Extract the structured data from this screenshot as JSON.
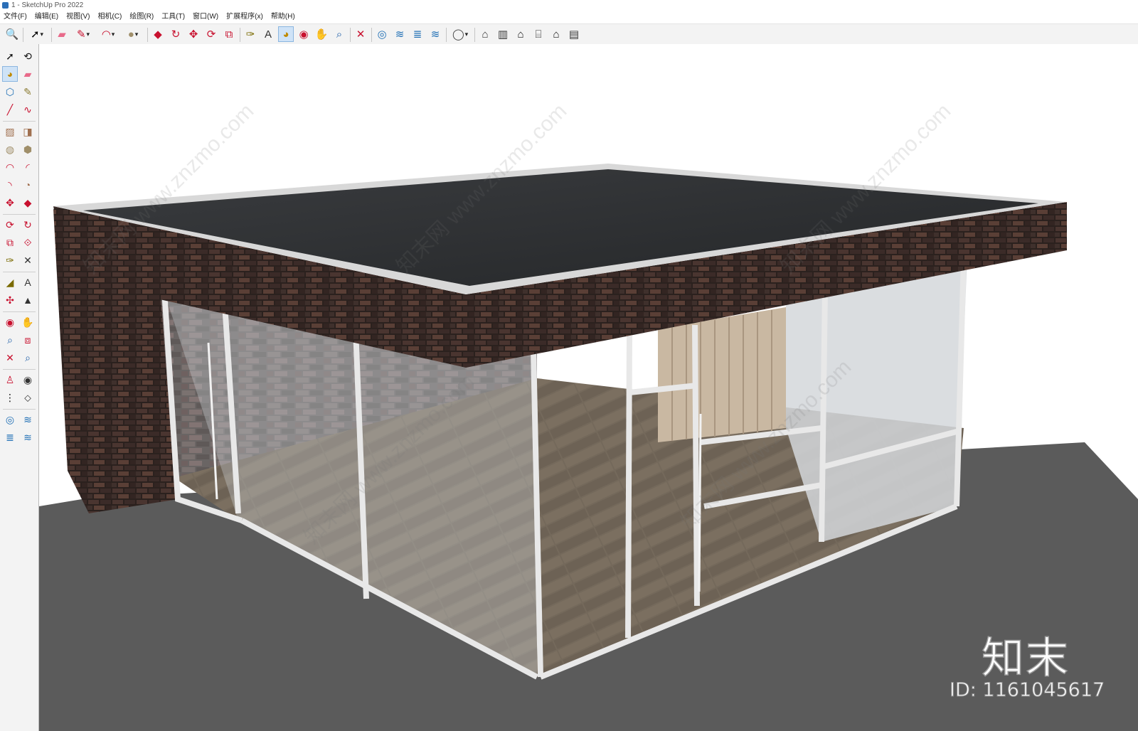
{
  "window": {
    "title": "1 - SketchUp Pro 2022"
  },
  "menu": [
    "文件(F)",
    "编辑(E)",
    "视图(V)",
    "相机(C)",
    "绘图(R)",
    "工具(T)",
    "窗口(W)",
    "扩展程序(x)",
    "帮助(H)"
  ],
  "top_tools": [
    {
      "name": "zoom-icon",
      "glyph": "🔍"
    },
    {
      "name": "select-icon",
      "glyph": "➚",
      "dropdown": true
    },
    {
      "name": "eraser-icon",
      "glyph": "▰",
      "color": "#e86a8a"
    },
    {
      "name": "pencil-icon",
      "glyph": "✎",
      "color": "#c8102e",
      "dropdown": true
    },
    {
      "name": "arc-icon",
      "glyph": "◠",
      "color": "#c8102e",
      "dropdown": true
    },
    {
      "name": "circle-icon",
      "glyph": "●",
      "color": "#a08f6a",
      "dropdown": true
    },
    {
      "name": "push-pull-icon",
      "glyph": "◆",
      "color": "#c8102e"
    },
    {
      "name": "follow-me-icon",
      "glyph": "↻",
      "color": "#c8102e"
    },
    {
      "name": "move-icon",
      "glyph": "✥",
      "color": "#c8102e"
    },
    {
      "name": "rotate-icon",
      "glyph": "⟳",
      "color": "#c8102e"
    },
    {
      "name": "scale-icon",
      "glyph": "⧉",
      "color": "#c8102e"
    },
    {
      "name": "tape-measure-icon",
      "glyph": "✑",
      "color": "#7a6a00"
    },
    {
      "name": "text-icon",
      "glyph": "A",
      "color": "#333"
    },
    {
      "name": "paint-bucket-icon",
      "glyph": "◕",
      "color": "#c08a00",
      "active": true
    },
    {
      "name": "orbit-icon",
      "glyph": "◉",
      "color": "#c8102e"
    },
    {
      "name": "pan-icon",
      "glyph": "✋",
      "color": "#c9a060"
    },
    {
      "name": "zoom-tool-icon",
      "glyph": "⌕",
      "color": "#1f5fa8"
    },
    {
      "name": "zoom-extents-icon",
      "glyph": "✕",
      "color": "#c8102e"
    },
    {
      "name": "warehouse-icon",
      "glyph": "◎",
      "color": "#1f6fb5"
    },
    {
      "name": "extension-warehouse-icon",
      "glyph": "≋",
      "color": "#1f6fb5"
    },
    {
      "name": "layers-icon",
      "glyph": "≣",
      "color": "#1f6fb5"
    },
    {
      "name": "send-to-layout-icon",
      "glyph": "≋",
      "color": "#1f6fb5"
    },
    {
      "name": "account-icon",
      "glyph": "◯",
      "color": "#444",
      "dropdown": true
    },
    {
      "name": "iso-view-icon",
      "glyph": "⌂",
      "color": "#333"
    },
    {
      "name": "top-view-icon",
      "glyph": "▥",
      "color": "#333"
    },
    {
      "name": "front-view-icon",
      "glyph": "⌂",
      "color": "#111"
    },
    {
      "name": "right-view-icon",
      "glyph": "⌸",
      "color": "#333"
    },
    {
      "name": "back-view-icon",
      "glyph": "⌂",
      "color": "#111"
    },
    {
      "name": "left-view-icon",
      "glyph": "▤",
      "color": "#333"
    }
  ],
  "left_tools": [
    {
      "name": "select-icon",
      "glyph": "➚",
      "color": "#111"
    },
    {
      "name": "orbit-icon",
      "glyph": "⟲",
      "color": "#111"
    },
    {
      "name": "paint-bucket-icon",
      "glyph": "◕",
      "color": "#c08a00",
      "active": true
    },
    {
      "name": "eraser-icon",
      "glyph": "▰",
      "color": "#e86a8a"
    },
    {
      "name": "component-icon",
      "glyph": "⬡",
      "color": "#1f6fb5"
    },
    {
      "name": "tag-icon",
      "glyph": "✎",
      "color": "#8a7a30"
    },
    {
      "name": "line-icon",
      "glyph": "╱",
      "color": "#c8102e"
    },
    {
      "name": "freehand-icon",
      "glyph": "∿",
      "color": "#c8102e"
    },
    {
      "name": "rectangle-icon",
      "glyph": "▨",
      "color": "#a07050"
    },
    {
      "name": "rotated-rectangle-icon",
      "glyph": "◨",
      "color": "#a07050"
    },
    {
      "name": "circle-icon",
      "glyph": "◍",
      "color": "#a08f6a"
    },
    {
      "name": "polygon-icon",
      "glyph": "⬢",
      "color": "#a08f6a"
    },
    {
      "name": "arc-icon",
      "glyph": "◠",
      "color": "#c8102e"
    },
    {
      "name": "two-point-arc-icon",
      "glyph": "◜",
      "color": "#c8102e"
    },
    {
      "name": "three-point-arc-icon",
      "glyph": "◝",
      "color": "#c8102e"
    },
    {
      "name": "pie-icon",
      "glyph": "◔",
      "color": "#a07050"
    },
    {
      "name": "move-icon",
      "glyph": "✥",
      "color": "#c8102e"
    },
    {
      "name": "push-pull-icon",
      "glyph": "◆",
      "color": "#c8102e"
    },
    {
      "name": "rotate-icon",
      "glyph": "⟳",
      "color": "#c8102e"
    },
    {
      "name": "follow-me-icon",
      "glyph": "↻",
      "color": "#c8102e"
    },
    {
      "name": "scale-icon",
      "glyph": "⧉",
      "color": "#c8102e"
    },
    {
      "name": "offset-icon",
      "glyph": "⟐",
      "color": "#c8102e"
    },
    {
      "name": "tape-measure-icon",
      "glyph": "✑",
      "color": "#7a6a00"
    },
    {
      "name": "dimension-icon",
      "glyph": "✕",
      "color": "#333"
    },
    {
      "name": "protractor-icon",
      "glyph": "◢",
      "color": "#7a6a00"
    },
    {
      "name": "text-icon",
      "glyph": "A",
      "color": "#333"
    },
    {
      "name": "axes-icon",
      "glyph": "✣",
      "color": "#c8102e"
    },
    {
      "name": "3d-text-icon",
      "glyph": "▲",
      "color": "#333"
    },
    {
      "name": "orbit-tool-icon",
      "glyph": "◉",
      "color": "#c8102e"
    },
    {
      "name": "pan-icon",
      "glyph": "✋",
      "color": "#c9a060"
    },
    {
      "name": "zoom-icon",
      "glyph": "⌕",
      "color": "#1f5fa8"
    },
    {
      "name": "zoom-window-icon",
      "glyph": "⧈",
      "color": "#c8102e"
    },
    {
      "name": "zoom-extents-icon",
      "glyph": "✕",
      "color": "#c8102e"
    },
    {
      "name": "previous-view-icon",
      "glyph": "⌕",
      "color": "#1f5fa8"
    },
    {
      "name": "position-camera-icon",
      "glyph": "♙",
      "color": "#c8102e"
    },
    {
      "name": "look-around-icon",
      "glyph": "◉",
      "color": "#333"
    },
    {
      "name": "walk-icon",
      "glyph": "⋮",
      "color": "#111"
    },
    {
      "name": "section-plane-icon",
      "glyph": "⬦",
      "color": "#333"
    },
    {
      "name": "warehouse-icon",
      "glyph": "◎",
      "color": "#1f6fb5"
    },
    {
      "name": "extension-warehouse-icon",
      "glyph": "≋",
      "color": "#1f6fb5"
    },
    {
      "name": "layers-icon",
      "glyph": "≣",
      "color": "#1f6fb5"
    },
    {
      "name": "send-to-layout-icon",
      "glyph": "≋",
      "color": "#1f6fb5"
    }
  ],
  "watermark": {
    "logo": "知末",
    "id": "ID: 1161045617",
    "repeat_text": "知末网 www.znzmo.com"
  },
  "colors": {
    "roof": "#2f3134",
    "brick": "#3a2a26",
    "floor": "#6f6456",
    "ground": "#5a5a5a",
    "frame": "#e4e4e4",
    "glass": "#c9cdd0"
  }
}
